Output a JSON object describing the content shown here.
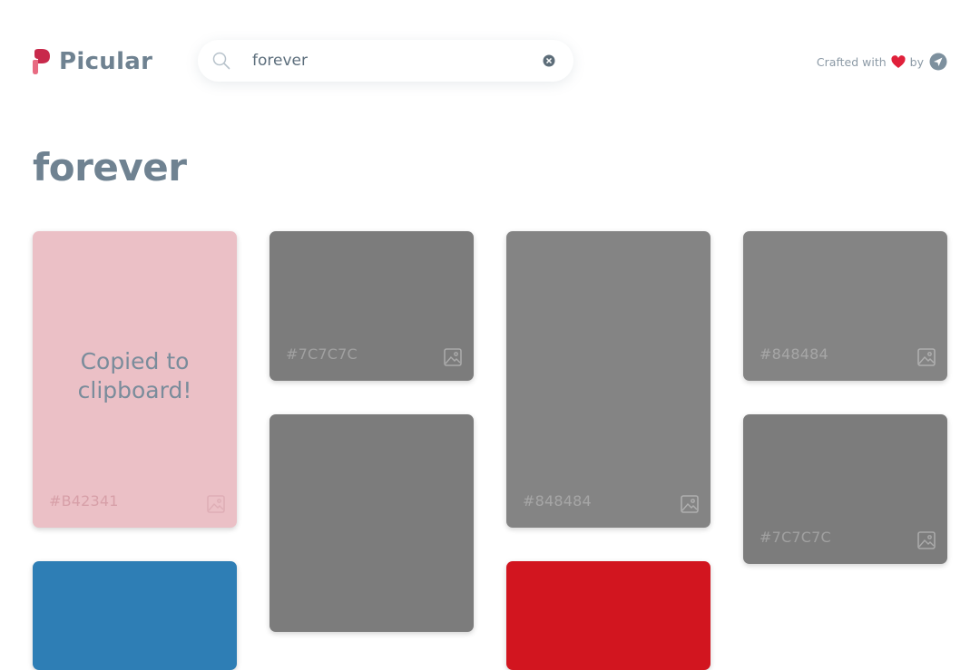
{
  "header": {
    "logo_text": "Picular",
    "search": {
      "value": "forever",
      "placeholder": ""
    },
    "crafted_text": "Crafted with",
    "by_text": "by"
  },
  "page_title": "forever",
  "copied_message_line1": "Copied to",
  "copied_message_line2": "clipboard!",
  "colors": {
    "brand": "#C8294B",
    "text": "#6F8291",
    "heart": "#E0203A"
  },
  "tiles": [
    {
      "hex": "#B42341",
      "color": "#EBC0C6",
      "state": "copied"
    },
    {
      "hex": "#7C7C7C",
      "color": "#7C7C7C"
    },
    {
      "hex": "",
      "color": "#7C7C7C"
    },
    {
      "hex": "#848484",
      "color": "#848484"
    },
    {
      "hex": "#848484",
      "color": "#848484"
    },
    {
      "hex": "#7C7C7C",
      "color": "#7C7C7C"
    },
    {
      "hex": "",
      "color": "#2E7EB5"
    },
    {
      "hex": "",
      "color": "#D2151F"
    }
  ]
}
